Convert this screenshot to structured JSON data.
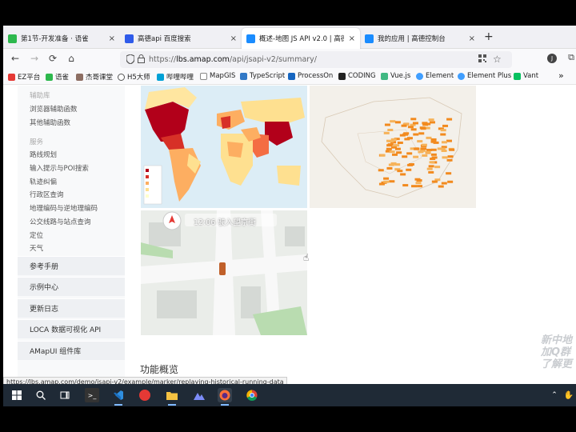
{
  "tabs": [
    {
      "label": "第1节-开发准备 · 语雀",
      "close": "×",
      "icon_color": "#2db84d",
      "active": false
    },
    {
      "label": "高德api 百度搜索",
      "close": "×",
      "icon_color": "#2f5bea",
      "active": false
    },
    {
      "label": "概述-地图 JS API v2.0 | 高德地",
      "close": "×",
      "icon_color": "#1a8cff",
      "active": true
    },
    {
      "label": "我的应用 | 高德控制台",
      "close": "×",
      "icon_color": "#1a8cff",
      "active": false
    }
  ],
  "new_tab": "+",
  "nav": {
    "back": "←",
    "forward": "→",
    "reload": "⟳",
    "home": "⌂"
  },
  "url": {
    "proto": "https://",
    "host": "lbs.amap.com",
    "path": "/api/jsapi-v2/summary/"
  },
  "bookmarks": [
    {
      "label": "EZ平台",
      "color": "#e53935"
    },
    {
      "label": "语雀",
      "color": "#2db84d"
    },
    {
      "label": "杰哥课堂",
      "color": "#8d6e63"
    },
    {
      "label": "H5大师",
      "color": "#555555"
    },
    {
      "label": "哔哩哔哩",
      "color": "#00a1d6"
    },
    {
      "label": "MapGIS",
      "color": "#888888"
    },
    {
      "label": "TypeScript",
      "color": "#3178c6"
    },
    {
      "label": "ProcessOn",
      "color": "#1565c0"
    },
    {
      "label": "CODING",
      "color": "#222222"
    },
    {
      "label": "Vue.js",
      "color": "#41b883"
    },
    {
      "label": "Element",
      "color": "#409eff"
    },
    {
      "label": "Element Plus",
      "color": "#409eff"
    },
    {
      "label": "Vant",
      "color": "#07c160"
    }
  ],
  "sidebar": {
    "group1_head": "辅助库",
    "group1": [
      "浏览器辅助函数",
      "其他辅助函数"
    ],
    "group2_head": "服务",
    "group2": [
      "路线规划",
      "输入提示与POI搜索",
      "轨迹纠偏",
      "行政区查询",
      "地理编码与逆地理编码",
      "公交线路与站点查询",
      "定位",
      "天气"
    ],
    "sections": [
      "参考手册",
      "示例中心",
      "更新日志",
      "LOCA 数据可视化 API",
      "AMapUI 组件库"
    ]
  },
  "nav_banner": "12:06 驶入望京街",
  "section_title": "功能概览",
  "watermark": [
    "新中地",
    "加Q群",
    "了解更"
  ],
  "status_url": "https://lbs.amap.com/demo/jsapi-v2/example/marker/replaying-historical-running-data",
  "colors": {
    "accent": "#1a8cff",
    "taskbar": "#1f2a36"
  }
}
